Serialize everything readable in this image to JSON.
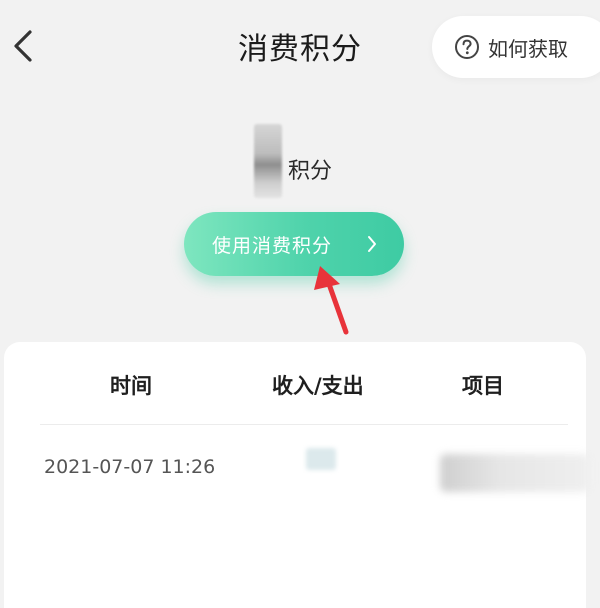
{
  "header": {
    "title": "消费积分",
    "help_label": "如何获取"
  },
  "points": {
    "unit_label": "积分"
  },
  "use_button": {
    "label": "使用消费积分"
  },
  "records": {
    "columns": [
      "时间",
      "收入/支出",
      "项目"
    ],
    "rows": [
      {
        "time": "2021-07-07 11:26"
      }
    ]
  },
  "colors": {
    "accent_start": "#7ee6bf",
    "accent_end": "#3ecba3",
    "annotation_arrow": "#e8333a",
    "background": "#f2f2f2"
  },
  "icons": {
    "back": "chevron-left-icon",
    "help": "question-circle-icon",
    "button_chevron": "chevron-right-icon"
  }
}
